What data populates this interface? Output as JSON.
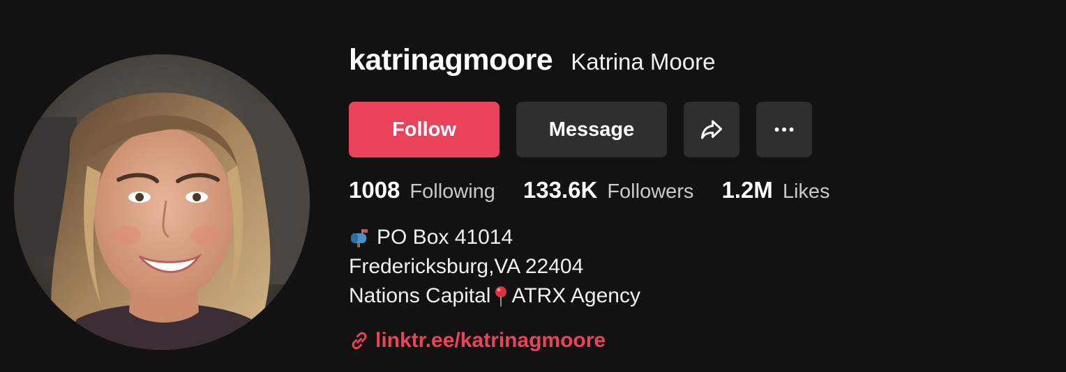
{
  "profile": {
    "username": "katrinagmoore",
    "display_name": "Katrina Moore"
  },
  "actions": {
    "follow_label": "Follow",
    "message_label": "Message",
    "share_icon": "share-arrow-icon",
    "more_icon": "more-dots-icon"
  },
  "stats": {
    "following_count": "1008",
    "following_label": "Following",
    "followers_count": "133.6K",
    "followers_label": "Followers",
    "likes_count": "1.2M",
    "likes_label": "Likes"
  },
  "bio": {
    "line1_icon": "mailbox-icon",
    "line1": "PO Box 41014",
    "line2": "Fredericksburg,VA 22404",
    "line3_a": "Nations Capital",
    "line3_icon": "pin-icon",
    "line3_b": "ATRX Agency"
  },
  "link": {
    "icon": "link-icon",
    "text": "linktr.ee/katrinagmoore"
  },
  "colors": {
    "background": "#121212",
    "accent": "#ea435b",
    "button_secondary": "#2f2f2f"
  }
}
